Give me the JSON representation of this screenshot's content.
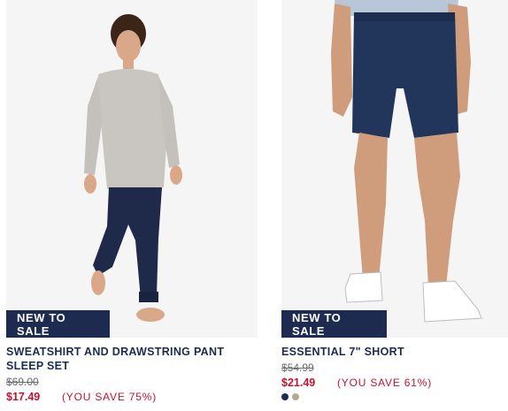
{
  "products": [
    {
      "badge": "NEW TO SALE",
      "name": "SWEATSHIRT AND DRAWSTRING PANT SLEEP SET",
      "original_price": "$69.00",
      "sale_price": "$17.49",
      "you_save": "(YOU SAVE 75%)",
      "image_alt": "Model wearing grey sweatshirt and navy drawstring pants"
    },
    {
      "badge": "NEW TO SALE",
      "name": "ESSENTIAL 7\" SHORT",
      "original_price": "$54.99",
      "sale_price": "$21.49",
      "you_save": "(YOU SAVE 61%)",
      "image_alt": "Model wearing navy shorts and white sneakers",
      "swatches": [
        "#1c2b4f",
        "#b8a892"
      ]
    }
  ],
  "colors": {
    "navy": "#1c2b4f",
    "sale_red": "#c8102e",
    "strike_grey": "#6b6b6b"
  }
}
